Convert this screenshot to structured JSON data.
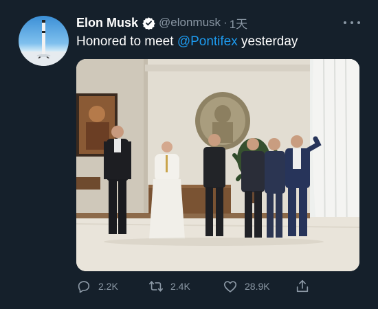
{
  "tweet": {
    "author_name": "Elon Musk",
    "handle": "@elonmusk",
    "separator": "·",
    "time": "1天",
    "text_before": "Honored to meet ",
    "mention": "@Pontifex",
    "text_after": " yesterday"
  },
  "icons": {
    "verified": "verified-badge-icon",
    "more": "more-options-icon",
    "reply": "reply-icon",
    "retweet": "retweet-icon",
    "like": "like-icon",
    "share": "share-icon"
  },
  "actions": {
    "reply_count": "2.2K",
    "retweet_count": "2.4K",
    "like_count": "28.9K"
  },
  "colors": {
    "background": "#15202b",
    "accent": "#1d9bf0",
    "secondary_text": "#8b98a5"
  }
}
